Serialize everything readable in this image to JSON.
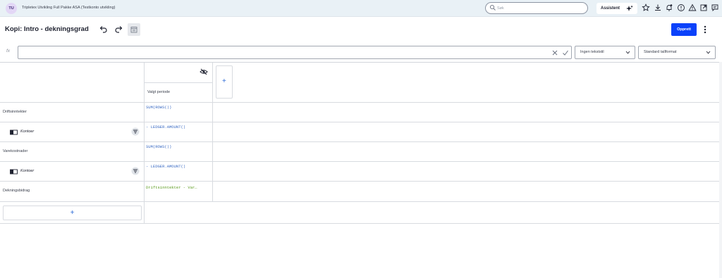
{
  "topbar": {
    "avatar_initials": "TU",
    "company": "Tripletex Utvikling Full Pakke ASA (Testkonto utvikling)",
    "search_placeholder": "Søk",
    "assistant_label": "Assistent"
  },
  "header": {
    "title": "Kopi: Intro - dekningsgrad",
    "create_label": "Opprett"
  },
  "formula_bar": {
    "fx_label": "fx",
    "value": "",
    "text_style": "Ingen tekststil",
    "number_format": "Standard tallformat"
  },
  "grid": {
    "column_header": "Valgt periode",
    "add_column_label": "+",
    "add_row_label": "+",
    "rows": [
      {
        "label": "Driftsinntekter",
        "formula": "SUM(ROWS())"
      },
      {
        "label": "Kontoer",
        "formula": "- LEDGER.AMOUNT()"
      },
      {
        "label": "Varekostnader",
        "formula": "SUM(ROWS())"
      },
      {
        "label": "Kontoer",
        "formula": "- LEDGER.AMOUNT()"
      },
      {
        "label": "Dekningsbidrag",
        "formula": "Driftsinntekter - Var…"
      }
    ]
  },
  "colors": {
    "accent": "#0a41fa",
    "topbar_bg": "#e9f1f6",
    "formula_blue": "#3c6cc4",
    "formula_green": "#5a9a1c"
  }
}
